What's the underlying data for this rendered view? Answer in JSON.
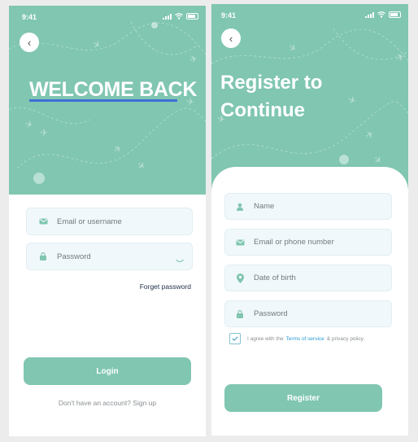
{
  "colors": {
    "accent": "#80c6b1",
    "field_bg": "#f1f8fb",
    "link": "#2a9bd6",
    "underline": "#3c6fd6"
  },
  "login": {
    "status_time": "9:41",
    "title": "WELCOME BACK",
    "email_placeholder": "Email or username",
    "password_placeholder": "Password",
    "forget_password": "Forget password",
    "login_button": "Login",
    "signup_prompt": "Don't have an account? Sign up"
  },
  "register": {
    "status_time": "9:41",
    "title_line1": "Register to",
    "title_line2": "Continue",
    "name_placeholder": "Name",
    "email_placeholder": "Email or phone number",
    "dob_placeholder": "Date of birth",
    "password_placeholder": "Password",
    "agree_prefix": "I agree with the",
    "terms_link": "Terms of service",
    "agree_suffix": "& privacy policy.",
    "terms_checked": true,
    "register_button": "Register"
  }
}
